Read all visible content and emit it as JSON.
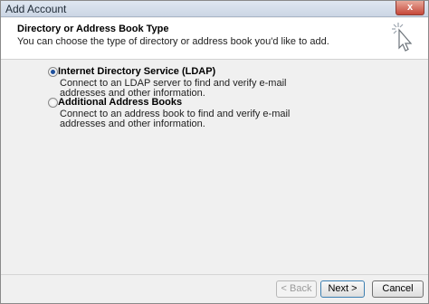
{
  "window": {
    "title": "Add Account",
    "close_label": "x"
  },
  "header": {
    "title": "Directory or Address Book Type",
    "description": "You can choose the type of directory or address book you'd like to add.",
    "icon": "cursor-click-icon"
  },
  "options": [
    {
      "label": "Internet Directory Service (LDAP)",
      "description": "Connect to an LDAP server to find and verify e-mail addresses and other information.",
      "selected": true
    },
    {
      "label": "Additional Address Books",
      "description": "Connect to an address book to find and verify e-mail addresses and other information.",
      "selected": false
    }
  ],
  "buttons": {
    "back": "< Back",
    "next": "Next >",
    "cancel": "Cancel"
  }
}
